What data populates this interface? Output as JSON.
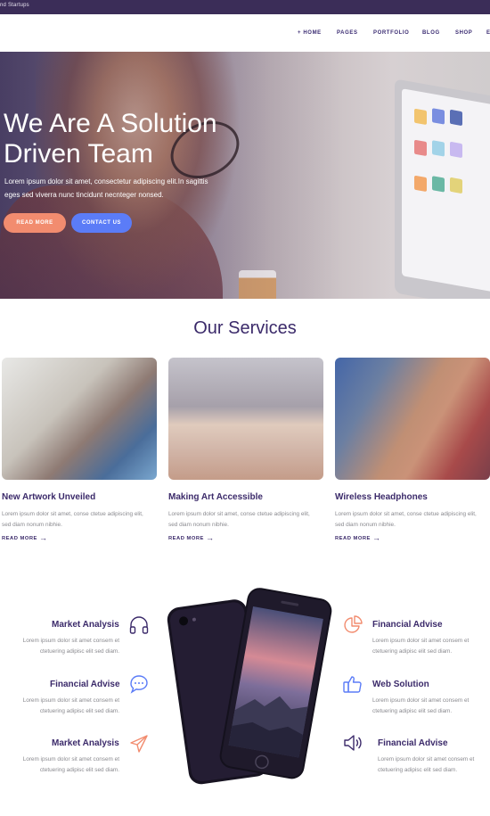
{
  "topbar": {
    "text": "nd Startups"
  },
  "nav": {
    "items": [
      {
        "label": "+ HOME"
      },
      {
        "label": "PAGES"
      },
      {
        "label": "PORTFOLIO"
      },
      {
        "label": "BLOG"
      },
      {
        "label": "SHOP"
      },
      {
        "label": "E"
      }
    ]
  },
  "hero": {
    "title_line1": "We Are A Solution",
    "title_line2": "Driven Team",
    "text_line1": "Lorem ipsum dolor sit amet, consectetur adipiscing elit.In sagittis",
    "text_line2": "eges sed viverra nunc tincidunt necnteger nonsed.",
    "read_more": "READ MORE",
    "contact_us": "CONTACT US"
  },
  "services": {
    "title": "Our Services",
    "cards": [
      {
        "title": "New Artwork Unveiled",
        "line1": "Lorem ipsum dolor sit amet, conse ctetue adipiscing elit,",
        "line2": "sed diam nonum nibhie.",
        "more": "READ MORE"
      },
      {
        "title": "Making Art Accessible",
        "line1": "Lorem ipsum dolor sit amet, conse ctetue adipiscing elit,",
        "line2": "sed diam nonum nibhie.",
        "more": "READ MORE"
      },
      {
        "title": "Wireless Headphones",
        "line1": "Lorem ipsum dolor sit amet, conse ctetue adipiscing elit,",
        "line2": "sed diam nonum nibhie.",
        "more": "READ MORE"
      }
    ]
  },
  "features": {
    "left": [
      {
        "title": "Market Analysis",
        "line1": "Lorem ipsum dolor sit amet consem et",
        "line2": "ctetuering adipisc elit sed diam.",
        "icon": "headphones-icon"
      },
      {
        "title": "Financial Advise",
        "line1": "Lorem ipsum dolor sit amet consem et",
        "line2": "ctetuering adipisc elit sed diam.",
        "icon": "chat-bubble-icon"
      },
      {
        "title": "Market Analysis",
        "line1": "Lorem ipsum dolor sit amet consem et",
        "line2": "ctetuering adipisc elit sed diam.",
        "icon": "paper-plane-icon"
      }
    ],
    "right": [
      {
        "title": "Financial Advise",
        "line1": "Lorem ipsum dolor sit amet consem et",
        "line2": "ctetuering adipisc elit sed diam.",
        "icon": "pie-chart-icon"
      },
      {
        "title": "Web Solution",
        "line1": "Lorem ipsum dolor sit amet consem et",
        "line2": "ctetuering adipisc elit sed diam.",
        "icon": "thumbs-up-icon"
      },
      {
        "title": "Financial Advise",
        "line1": "Lorem ipsum dolor sit amet consem et",
        "line2": "ctetuering adipisc elit sed diam.",
        "icon": "speaker-icon"
      }
    ]
  },
  "colors": {
    "primary": "#3b2a6a",
    "accent_orange": "#f28c6f",
    "accent_blue": "#5b7cf7",
    "topbar": "#3b2d58"
  }
}
